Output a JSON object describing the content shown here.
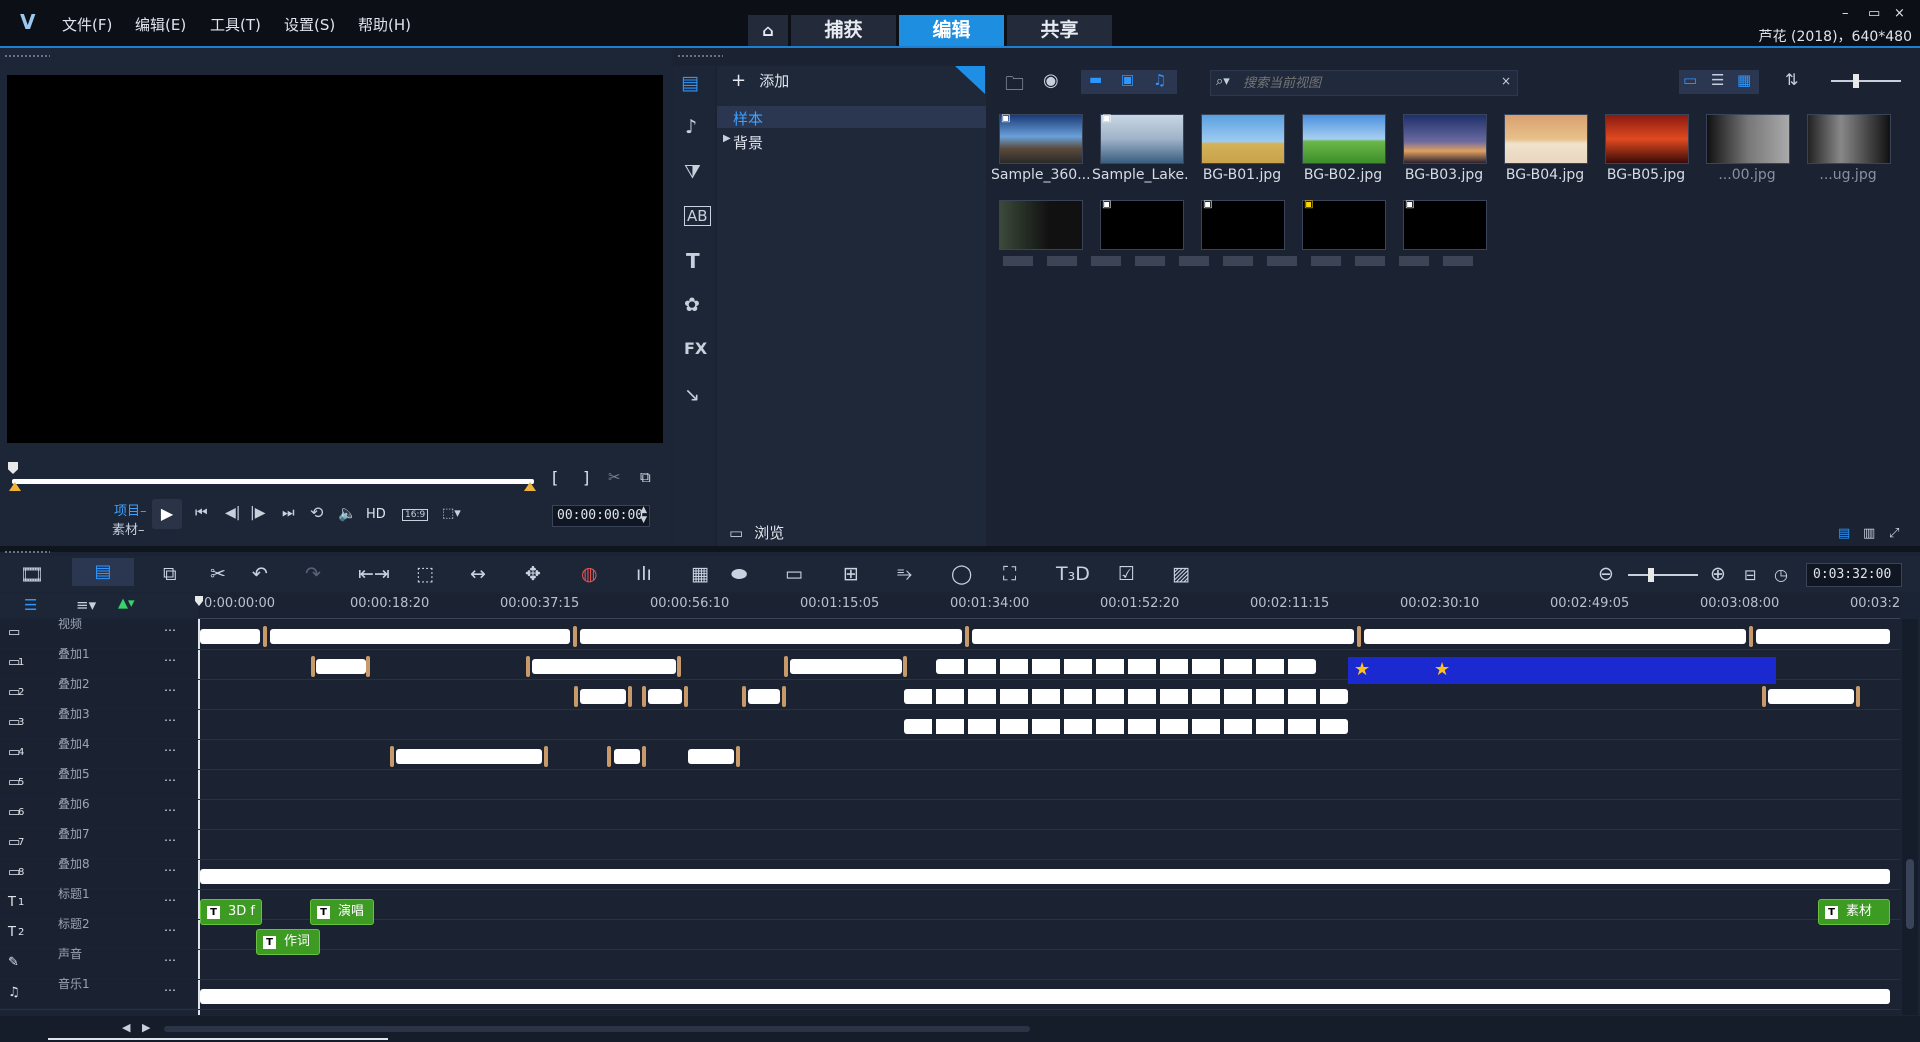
{
  "app": {
    "menu": [
      "文件(F)",
      "编辑(E)",
      "工具(T)",
      "设置(S)",
      "帮助(H)"
    ],
    "mode_tabs": [
      "捕获",
      "编辑",
      "共享"
    ],
    "active_tab": "编辑",
    "project_info": "芦花 (2018)，640*480",
    "window_buttons": [
      "–",
      "▭",
      "×"
    ]
  },
  "preview": {
    "mode_project": "项目–",
    "mode_clip": "素材–",
    "hd_label": "HD",
    "aspect_label": "16:9",
    "timecode": "00:00:00:00",
    "mark_in": "[",
    "mark_out": "]"
  },
  "library": {
    "add_label": "添加",
    "tree": [
      "样本",
      "背景"
    ],
    "browse_label": "浏览",
    "search_placeholder": "搜索当前视图",
    "category_icons": [
      "media-icon",
      "music-icon",
      "transition-icon",
      "title-icon",
      "text-icon",
      "graphics-icon",
      "fx-icon",
      "path-icon"
    ],
    "fx_label": "FX",
    "thumbnails_row1": [
      "Sample_360....",
      "Sample_Lake....",
      "BG-B01.jpg",
      "BG-B02.jpg",
      "BG-B03.jpg",
      "BG-B04.jpg",
      "BG-B05.jpg",
      "",
      ""
    ],
    "thumbnails_row1_partial": [
      "...00.jpg",
      "...ug.jpg"
    ]
  },
  "timeline": {
    "zoom_time": "0:03:32:00",
    "ruler": [
      "0:00:00:00",
      "00:00:18:20",
      "00:00:37:15",
      "00:00:56:10",
      "00:01:15:05",
      "00:01:34:00",
      "00:01:52:20",
      "00:02:11:15",
      "00:02:30:10",
      "00:02:49:05",
      "00:03:08:00",
      "00:03:2"
    ],
    "tracks": [
      {
        "num": "",
        "name": "视频"
      },
      {
        "num": "1",
        "name": "叠加1"
      },
      {
        "num": "2",
        "name": "叠加2"
      },
      {
        "num": "3",
        "name": "叠加3"
      },
      {
        "num": "4",
        "name": "叠加4"
      },
      {
        "num": "5",
        "name": "叠加5"
      },
      {
        "num": "6",
        "name": "叠加6"
      },
      {
        "num": "7",
        "name": "叠加7"
      },
      {
        "num": "8",
        "name": "叠加8"
      },
      {
        "num": "1",
        "name": "标题1"
      },
      {
        "num": "2",
        "name": "标题2"
      },
      {
        "num": "",
        "name": "声音"
      },
      {
        "num": "",
        "name": "音乐1"
      }
    ],
    "title_clips": [
      "3D f",
      "演唱",
      "作词",
      "素材"
    ]
  }
}
